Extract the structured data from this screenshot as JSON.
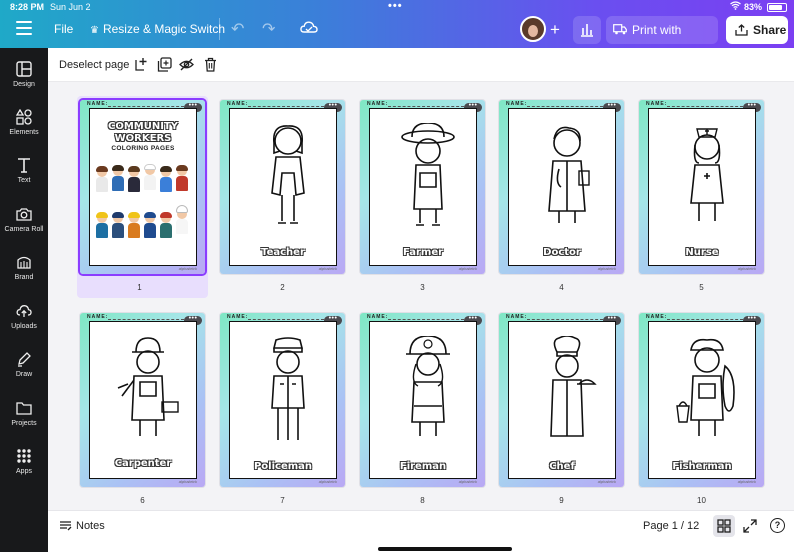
{
  "status_bar": {
    "time": "8:28 PM",
    "date": "Sun Jun 2",
    "battery": "83%"
  },
  "topbar": {
    "file_label": "File",
    "resize_label": "Resize & Magic Switch",
    "print_label": "Print with Canva",
    "share_label": "Share"
  },
  "sidebar": {
    "items": [
      {
        "label": "Design"
      },
      {
        "label": "Elements"
      },
      {
        "label": "Text"
      },
      {
        "label": "Camera Roll"
      },
      {
        "label": "Brand"
      },
      {
        "label": "Uploads"
      },
      {
        "label": "Draw"
      },
      {
        "label": "Projects"
      },
      {
        "label": "Apps"
      }
    ]
  },
  "page_toolbar": {
    "deselect_label": "Deselect page"
  },
  "cover": {
    "title_line1": "COMMUNITY",
    "title_line2": "WORKERS",
    "subtitle": "COLORING PAGES"
  },
  "pages": [
    {
      "number": "1",
      "caption": ""
    },
    {
      "number": "2",
      "caption": "Teacher"
    },
    {
      "number": "3",
      "caption": "Farmer"
    },
    {
      "number": "4",
      "caption": "Doctor"
    },
    {
      "number": "5",
      "caption": "Nurse"
    },
    {
      "number": "6",
      "caption": "Carpenter"
    },
    {
      "number": "7",
      "caption": "Policeman"
    },
    {
      "number": "8",
      "caption": "Fireman"
    },
    {
      "number": "9",
      "caption": "Chef"
    },
    {
      "number": "10",
      "caption": "Fisherman"
    }
  ],
  "page_labels": {
    "name_field": "NAME:",
    "signature": "alphabrick"
  },
  "bottom_bar": {
    "notes_label": "Notes",
    "page_indicator": "Page 1 / 12",
    "help_label": "?"
  },
  "colors": {
    "accent": "#8b3dff",
    "sidebar_bg": "#18191b"
  }
}
